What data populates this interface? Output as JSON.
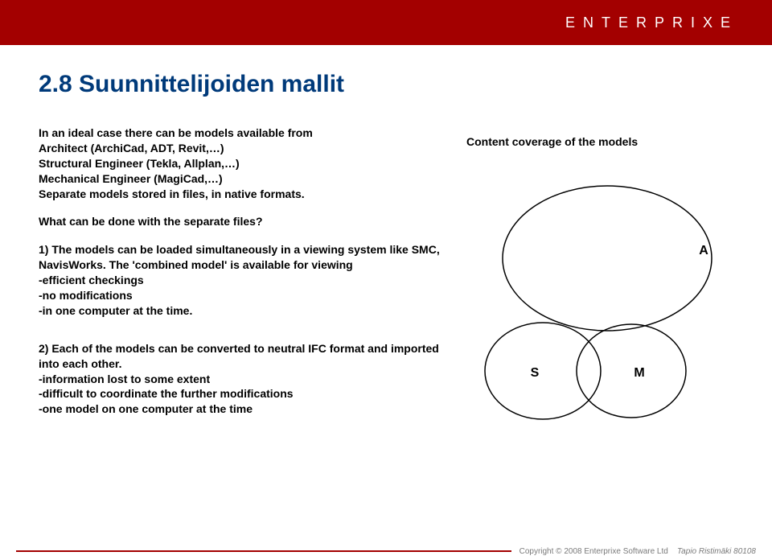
{
  "header": {
    "logo": "ENTERPRIXE"
  },
  "title": "2.8 Suunnittelijoiden mallit",
  "intro": "In an ideal case there can be models available from\nArchitect (ArchiCad, ADT, Revit,…)\nStructural Engineer (Tekla, Allplan,…)\nMechanical Engineer (MagiCad,…)\nSeparate models stored in files, in native formats.",
  "what_heading": "What can be done with the separate files?",
  "point1": "1) The models can be loaded simultaneously in a viewing system like SMC, NavisWorks. The 'combined model' is available for viewing\n-efficient checkings\n-no modifications\n-in one computer at the time.",
  "point2": "2) Each of the models can be converted to neutral IFC format and imported into each other.\n-information lost to some extent\n-difficult to coordinate the further modifications\n-one model on one computer at the time",
  "diagram": {
    "caption": "Content coverage of the models",
    "labels": {
      "A": "A",
      "S": "S",
      "M": "M"
    }
  },
  "footer": {
    "copyright": "Copyright © 2008 Enterprixe Software Ltd",
    "author": "Tapio Ristimäki 80108"
  }
}
